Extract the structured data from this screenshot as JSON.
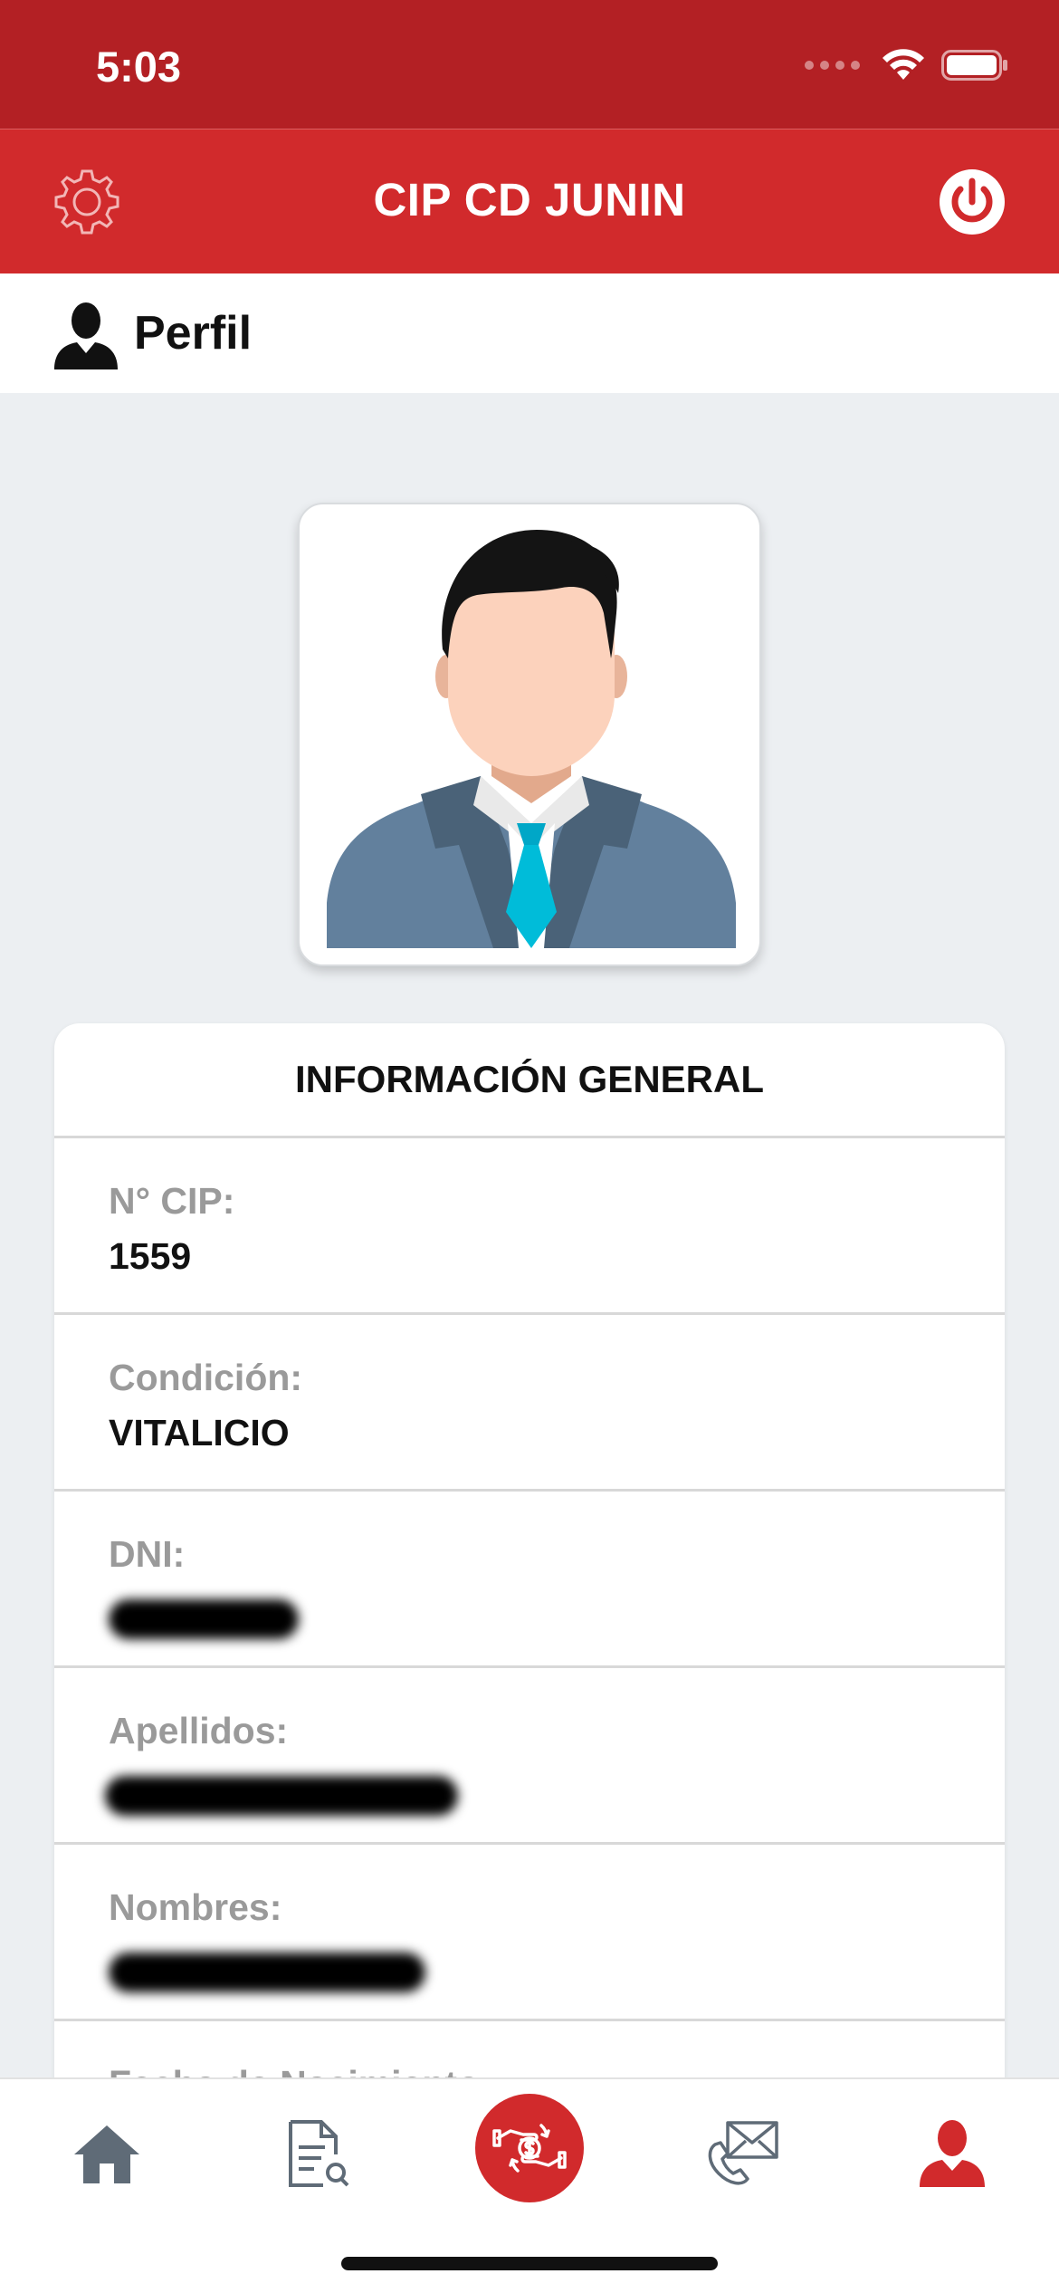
{
  "status_bar": {
    "time": "5:03"
  },
  "header": {
    "title": "CIP CD JUNIN"
  },
  "profile": {
    "title": "Perfil"
  },
  "info": {
    "title": "INFORMACIÓN GENERAL",
    "rows": [
      {
        "label": "N° CIP:",
        "value": "1559"
      },
      {
        "label": "Condición:",
        "value": "VITALICIO"
      },
      {
        "label": "DNI:",
        "value": ""
      },
      {
        "label": "Apellidos:",
        "value": ""
      },
      {
        "label": "Nombres:",
        "value": ""
      },
      {
        "label": "Fecha de Nacimiento:",
        "value": ""
      }
    ]
  },
  "tabs": [
    {
      "name": "home-icon"
    },
    {
      "name": "document-search-icon"
    },
    {
      "name": "payment-icon"
    },
    {
      "name": "contact-icon"
    },
    {
      "name": "profile-icon"
    }
  ],
  "colors": {
    "brand_red": "#d12a2c",
    "status_red": "#b32024",
    "background": "#eceff2"
  }
}
